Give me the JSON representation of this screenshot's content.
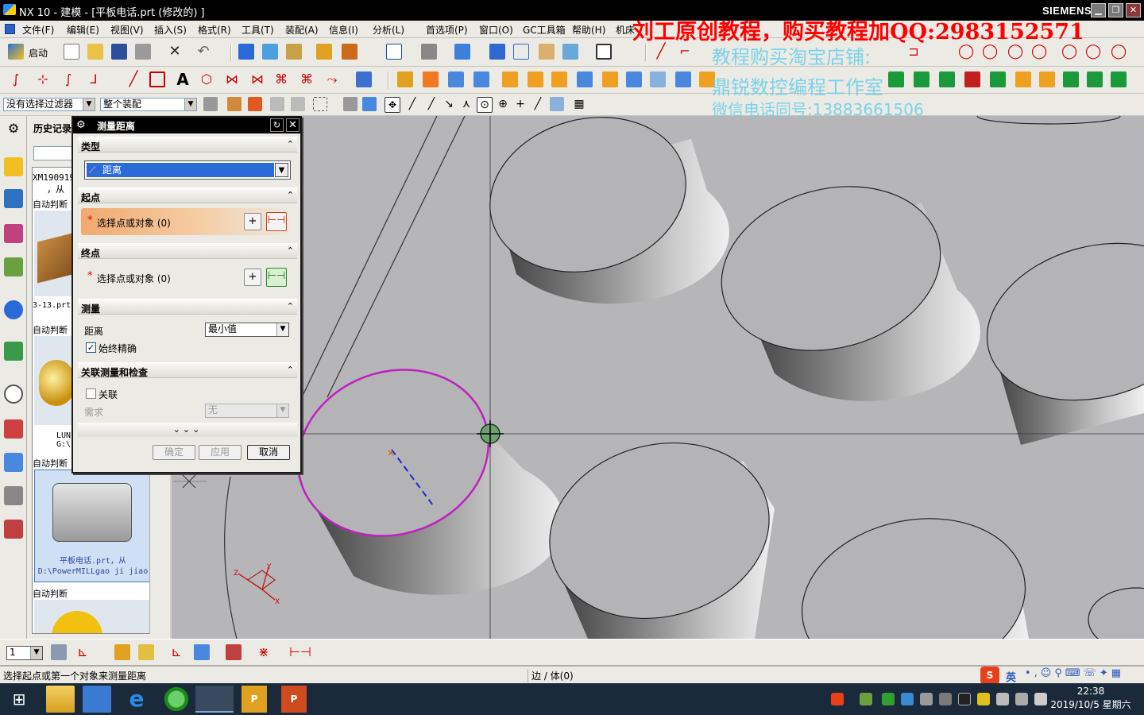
{
  "window": {
    "title": "NX 10 - 建模 - [平板电话.prt  (修改的) ]",
    "brand": "SIEMENS"
  },
  "menu": [
    "文件(F)",
    "编辑(E)",
    "视图(V)",
    "插入(S)",
    "格式(R)",
    "工具(T)",
    "装配(A)",
    "信息(I)",
    "分析(L)",
    "首选项(P)",
    "窗口(O)",
    "GC工具箱",
    "帮助(H)",
    "机床"
  ],
  "toolbar": {
    "start_label": "启动"
  },
  "selection_bar": {
    "filter": "没有选择过滤器",
    "scope": "整个装配"
  },
  "watermark": {
    "line1": "刘工原创教程，购买教程加QQ:2983152571",
    "line2": "教程购买淘宝店铺:",
    "line3": "鼎锐数控编程工作室",
    "line4": "微信电话同号:13883661506"
  },
  "history_panel": {
    "title": "历史记录",
    "items": [
      {
        "text": "XM190919",
        "sub": "，从"
      },
      {
        "text": "自动判断"
      },
      {
        "text": "3-13.prt"
      },
      {
        "text": "自动判断"
      },
      {
        "text": "LUN",
        "sub": "G:\\"
      },
      {
        "text": "自动判断"
      },
      {
        "text": "平板电话.prt，从",
        "sub": "D:\\PowerMILLgao ji jiao"
      },
      {
        "text": "自动判断"
      }
    ]
  },
  "dialog": {
    "title": "测量距离",
    "sections": {
      "type": "类型",
      "start": "起点",
      "end": "终点",
      "measure": "测量",
      "assoc": "关联测量和检查"
    },
    "type_value": "距离",
    "start_select": "选择点或对象 (0)",
    "end_select": "选择点或对象 (0)",
    "distance_label": "距离",
    "distance_value": "最小值",
    "always_accurate": "始终精确",
    "always_accurate_checked": true,
    "associative": "关联",
    "associative_checked": false,
    "requirement_label": "需求",
    "requirement_value": "无",
    "buttons": {
      "ok": "确定",
      "apply": "应用",
      "cancel": "取消"
    }
  },
  "bottom_toolbar": {
    "layer_value": "1"
  },
  "status": {
    "prompt": "选择起点或第一个对象来测量距离",
    "info": "边 / 体(0)"
  },
  "tray": {
    "ime": "英",
    "time": "22:38",
    "date": "2019/10/5 星期六"
  },
  "colors": {
    "selection_highlight": "#c020c0",
    "accent_orange": "#f2a96e",
    "title_bar": "#000000"
  }
}
